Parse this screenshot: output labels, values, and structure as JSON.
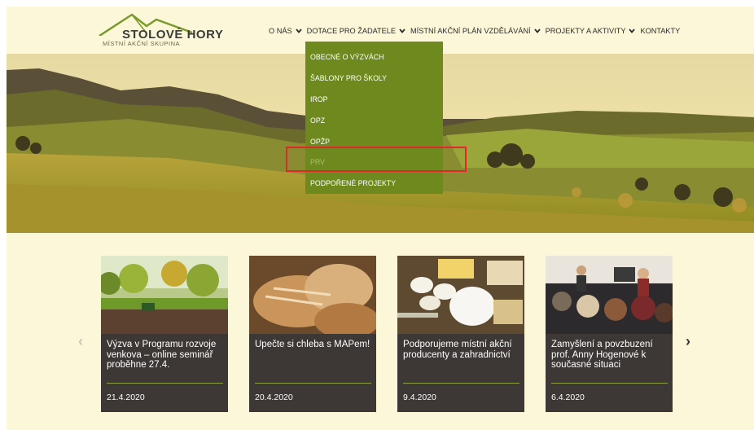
{
  "logo": {
    "name": "STOLOVÉ HORY",
    "subtitle": "MÍSTNÍ AKČNÍ SKUPINA"
  },
  "nav": {
    "items": [
      {
        "label": "O NÁS",
        "has_dropdown": true
      },
      {
        "label": "DOTACE PRO ŽADATELE",
        "has_dropdown": true
      },
      {
        "label": "MÍSTNÍ AKČNÍ PLÁN VZDĚLÁVÁNÍ",
        "has_dropdown": true
      },
      {
        "label": "PROJEKTY A AKTIVITY",
        "has_dropdown": true
      },
      {
        "label": "KONTAKTY",
        "has_dropdown": false
      }
    ]
  },
  "dropdown": {
    "items": [
      {
        "label": "OBECNÉ O VÝZVÁCH"
      },
      {
        "label": "ŠABLONY PRO ŠKOLY"
      },
      {
        "label": "IROP"
      },
      {
        "label": "OPZ"
      },
      {
        "label": "OPŽP"
      },
      {
        "label": "PRV",
        "active": true
      },
      {
        "label": "PODPOŘENÉ PROJEKTY"
      }
    ],
    "highlighted": "PRV"
  },
  "carousel": {
    "prev_icon": "chevron-left-icon",
    "next_icon": "chevron-right-icon",
    "prev_glyph": "‹",
    "next_glyph": "›",
    "cards": [
      {
        "title": "Výzva v Programu rozvoje venkova – online seminář proběhne 27.4.",
        "date": "21.4.2020",
        "image": "tractor-field-photo"
      },
      {
        "title": "Upečte si chleba s MAPem!",
        "date": "20.4.2020",
        "image": "bread-photo"
      },
      {
        "title": "Podporujeme místní akční producenty a zahradnictví",
        "date": "9.4.2020",
        "image": "eggs-milk-photo"
      },
      {
        "title": "Zamyšlení a povzbuzení prof. Anny Hogenové k současné situaci",
        "date": "6.4.2020",
        "image": "lecture-audience-photo"
      }
    ]
  },
  "colors": {
    "background": "#fbf7d8",
    "dropdown": "#6e8a1e",
    "card": "#3d3735",
    "accent_line": "#8aa33a",
    "highlight_box": "#e3262b"
  }
}
